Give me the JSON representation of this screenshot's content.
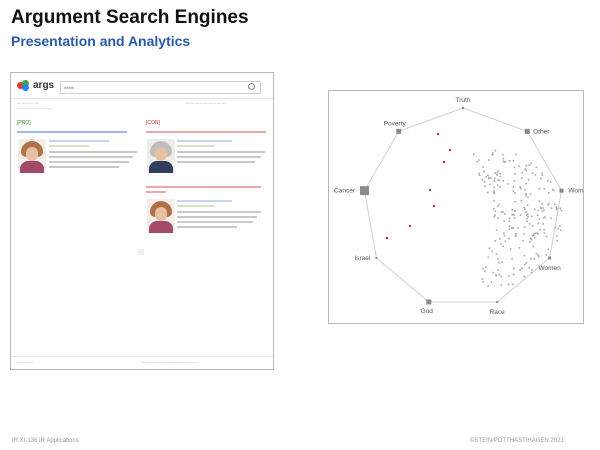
{
  "slide": {
    "title": "Argument Search Engines",
    "subtitle": "Presentation and Analytics"
  },
  "screenshot": {
    "logo_text": "args",
    "search_value": "death ...",
    "pro_label": "[PRO]",
    "con_label": "[CON]"
  },
  "radial": {
    "labels": [
      "Truth",
      "Other",
      "Women",
      "Women",
      "Race",
      "God",
      "Israel",
      "Cancer",
      "Poverty"
    ]
  },
  "footer": {
    "left": "IR:XI-136  IR Applications",
    "right": "©STEIN/POTTHAST/HAGEN 2021"
  },
  "colors": {
    "pro": "#2e8b2e",
    "con": "#c62828",
    "link": "#2a6ad0",
    "subtitle": "#2a5aa8"
  }
}
